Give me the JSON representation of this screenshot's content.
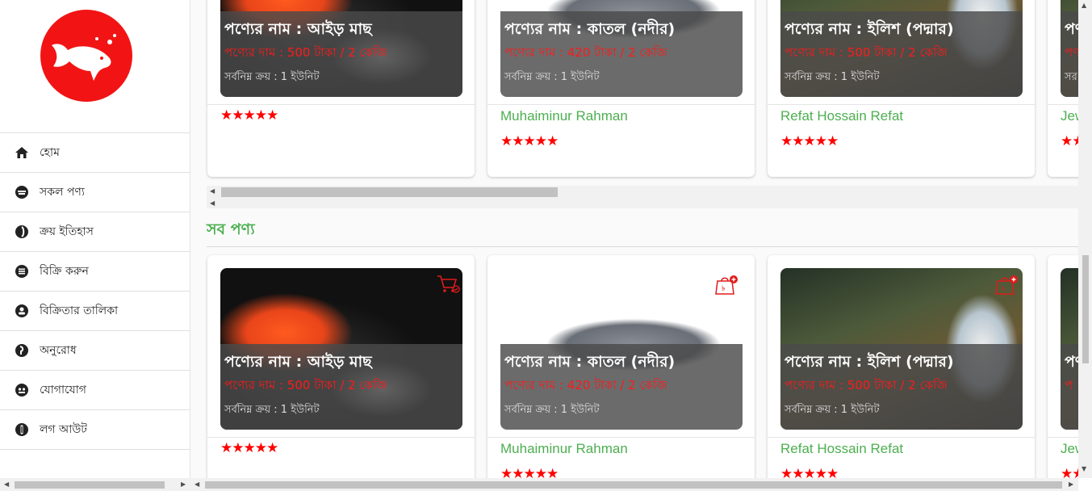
{
  "sidebar": {
    "menu": [
      {
        "label": "হোম",
        "icon": "home-icon"
      },
      {
        "label": "সকল পণ্য",
        "icon": "products-icon"
      },
      {
        "label": "ক্রয় ইতিহাস",
        "icon": "history-icon"
      },
      {
        "label": "বিক্রি করুন",
        "icon": "sell-icon"
      },
      {
        "label": "বিক্রিতার তালিকা",
        "icon": "sellers-icon"
      },
      {
        "label": "অনুরোধ",
        "icon": "request-icon"
      },
      {
        "label": "যোগাযোগ",
        "icon": "contact-icon"
      },
      {
        "label": "লগ আউট",
        "icon": "logout-icon"
      }
    ]
  },
  "top_cards": [
    {
      "name": "পণ্যের নাম : আইড় মাছ",
      "price": "পণ্যের দাম : 500 টাকা / 2 কেজি",
      "min": "সর্বনিম্ন ক্রয় : 1 ইউনিট",
      "seller": "",
      "stars": "★★★★★"
    },
    {
      "name": "পণ্যের নাম : কাতল (নদীর)",
      "price": "পণ্যের দাম : 420 টাকা / 2 কেজি",
      "min": "সর্বনিম্ন ক্রয় : 1 ইউনিট",
      "seller": "Muhaiminur Rahman",
      "stars": "★★★★★"
    },
    {
      "name": "পণ্যের নাম : ইলিশ (পদ্মার)",
      "price": "পণ্যের দাম : 500 টাকা / 2 কেজি",
      "min": "সর্বনিম্ন ক্রয় : 1 ইউনিট",
      "seller": "Refat Hossain Refat",
      "stars": "★★★★★"
    },
    {
      "name": "পণ",
      "price": "পণ",
      "min": "সর",
      "seller": "Jew",
      "stars": "★★"
    }
  ],
  "section_title": "সব পণ্য",
  "bottom_cards": [
    {
      "name": "পণ্যের নাম : আইড় মাছ",
      "price": "পণ্যের দাম : 500 টাকা / 2 কেজি",
      "min": "সর্বনিম্ন ক্রয় : 1 ইউনিট",
      "seller": "",
      "stars": "★★★★★",
      "cart_icon": "cart-check-icon"
    },
    {
      "name": "পণ্যের নাম : কাতল (নদীর)",
      "price": "পণ্যের দাম : 420 টাকা / 2 কেজি",
      "min": "সর্বনিম্ন ক্রয় : 1 ইউনিট",
      "seller": "Muhaiminur Rahman",
      "stars": "★★★★★",
      "cart_icon": "bag-add-icon"
    },
    {
      "name": "পণ্যের নাম : ইলিশ (পদ্মার)",
      "price": "পণ্যের দাম : 500 টাকা / 2 কেজি",
      "min": "সর্বনিম্ন ক্রয় : 1 ইউনিট",
      "seller": "Refat Hossain Refat",
      "stars": "★★★★★",
      "cart_icon": "bag-add-icon"
    },
    {
      "name": "পণ",
      "price": "প",
      "min": "",
      "seller": "Jew",
      "stars": "★★"
    }
  ],
  "colors": {
    "brand_red": "#f21414",
    "seller_green": "#4caf50",
    "price_red": "#ff1a1a"
  }
}
